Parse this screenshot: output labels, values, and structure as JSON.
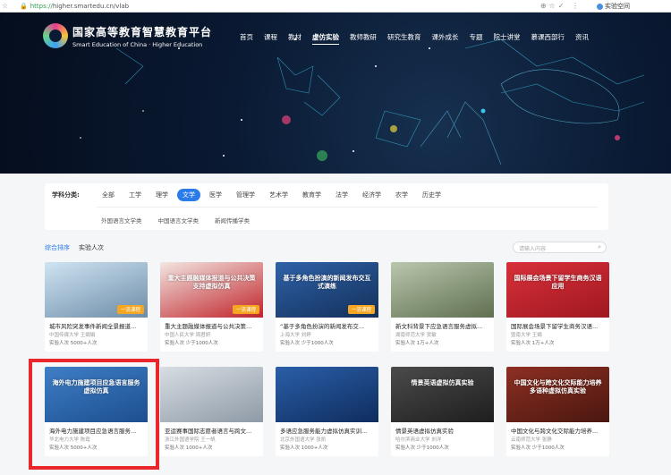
{
  "browser": {
    "protocol": "https://",
    "url": "higher.smartedu.cn/vlab",
    "extension_label": "实验空间"
  },
  "header": {
    "logo_cn": "国家高等教育智慧教育平台",
    "logo_en": "Smart Education of China · Higher Education",
    "nav": [
      "首页",
      "课程",
      "教材",
      "虚仿实验",
      "教师教研",
      "研究生教育",
      "课外成长",
      "专题",
      "院士讲堂",
      "慕课西部行",
      "资讯"
    ],
    "active_nav": "虚仿实验"
  },
  "filter": {
    "label": "学科分类:",
    "subjects": [
      "全部",
      "工学",
      "理学",
      "文学",
      "医学",
      "管理学",
      "艺术学",
      "教育学",
      "法学",
      "经济学",
      "农学",
      "历史学"
    ],
    "active_subject": "文学",
    "subcategories": [
      "外国语言文学类",
      "中国语言文学类",
      "新闻传播学类"
    ]
  },
  "sort": {
    "options": [
      "综合排序",
      "实验人次"
    ],
    "active": "综合排序",
    "search_placeholder": "请输入内容"
  },
  "cards": [
    {
      "title": "城市风险突发事件新闻全景报道...",
      "meta": "中国传媒大学 王娟娟",
      "visits": "实验人次 5000+人次",
      "badge": "一流课程",
      "thumb_text": "",
      "colors": [
        "#cfe4f2",
        "#6d8ca8"
      ]
    },
    {
      "title": "重大主题融媒体报道与公共决策...",
      "meta": "中国人民大学 周君妍",
      "visits": "实验人次 少于1000人次",
      "badge": "一流课程",
      "thumb_text": "重大主题融媒体报道与公共决策支持虚拟仿真",
      "colors": [
        "#f3e6e2",
        "#c0232a"
      ]
    },
    {
      "title": "“基于多角色扮演的新闻发布交...",
      "meta": "上海大学 刘婷",
      "visits": "实验人次 少于1000人次",
      "badge": "一流课程",
      "thumb_text": "基于多角色扮演的新闻发布交互式演练",
      "colors": [
        "#2f62a8",
        "#13305a"
      ]
    },
    {
      "title": "新文科背景下应急语言服务虚拟...",
      "meta": "湖南师范大学 贺敏",
      "visits": "实验人次 1万+人次",
      "badge": "",
      "thumb_text": "",
      "colors": [
        "#b9c7ad",
        "#5f6f4f"
      ]
    },
    {
      "title": "国际展会场景下留学生商务汉语...",
      "meta": "暨南大学 王娟",
      "visits": "实验人次 1万+人次",
      "badge": "",
      "thumb_text": "国际展会场景下留学生商务汉语应用",
      "colors": [
        "#d8303a",
        "#a01820"
      ]
    },
    {
      "title": "海外电力施建项目应急语言服务...",
      "meta": "华北电力大学 陈霞",
      "visits": "实验人次 5000+人次",
      "badge": "",
      "thumb_text": "海外电力施建项目应急语言服务虚拟仿真",
      "colors": [
        "#3f7ec6",
        "#1c4f8f"
      ]
    },
    {
      "title": "亚运赛事国际志愿者语言与跨文...",
      "meta": "浙江外国语学院 王一帆",
      "visits": "实验人次 1000+人次",
      "badge": "",
      "thumb_text": "",
      "colors": [
        "#d7dde3",
        "#8e9aa6"
      ]
    },
    {
      "title": "多语应急服务能力虚拟仿真实训...",
      "meta": "北京外国语大学 张凯",
      "visits": "实验人次 1000+人次",
      "badge": "",
      "thumb_text": "",
      "colors": [
        "#2a5ea8",
        "#0f2d5e"
      ]
    },
    {
      "title": "情景英语虚拟仿真实验",
      "meta": "哈尔滨商业大学 刘洋",
      "visits": "实验人次 少于1000人次",
      "badge": "",
      "thumb_text": "情景英语虚拟仿真实验",
      "colors": [
        "#4b4b4b",
        "#1e1e1e"
      ]
    },
    {
      "title": "中国文化与跨文化交际能力培养...",
      "meta": "云南师范大学 张静",
      "visits": "实验人次 少于1000人次",
      "badge": "",
      "thumb_text": "中国文化与跨文化交际能力培养多语种虚拟仿真实验",
      "colors": [
        "#8e2f22",
        "#4a1710"
      ]
    }
  ],
  "icons": [
    "lock-icon",
    "search-icon",
    "star-icon",
    "menu-icon"
  ]
}
